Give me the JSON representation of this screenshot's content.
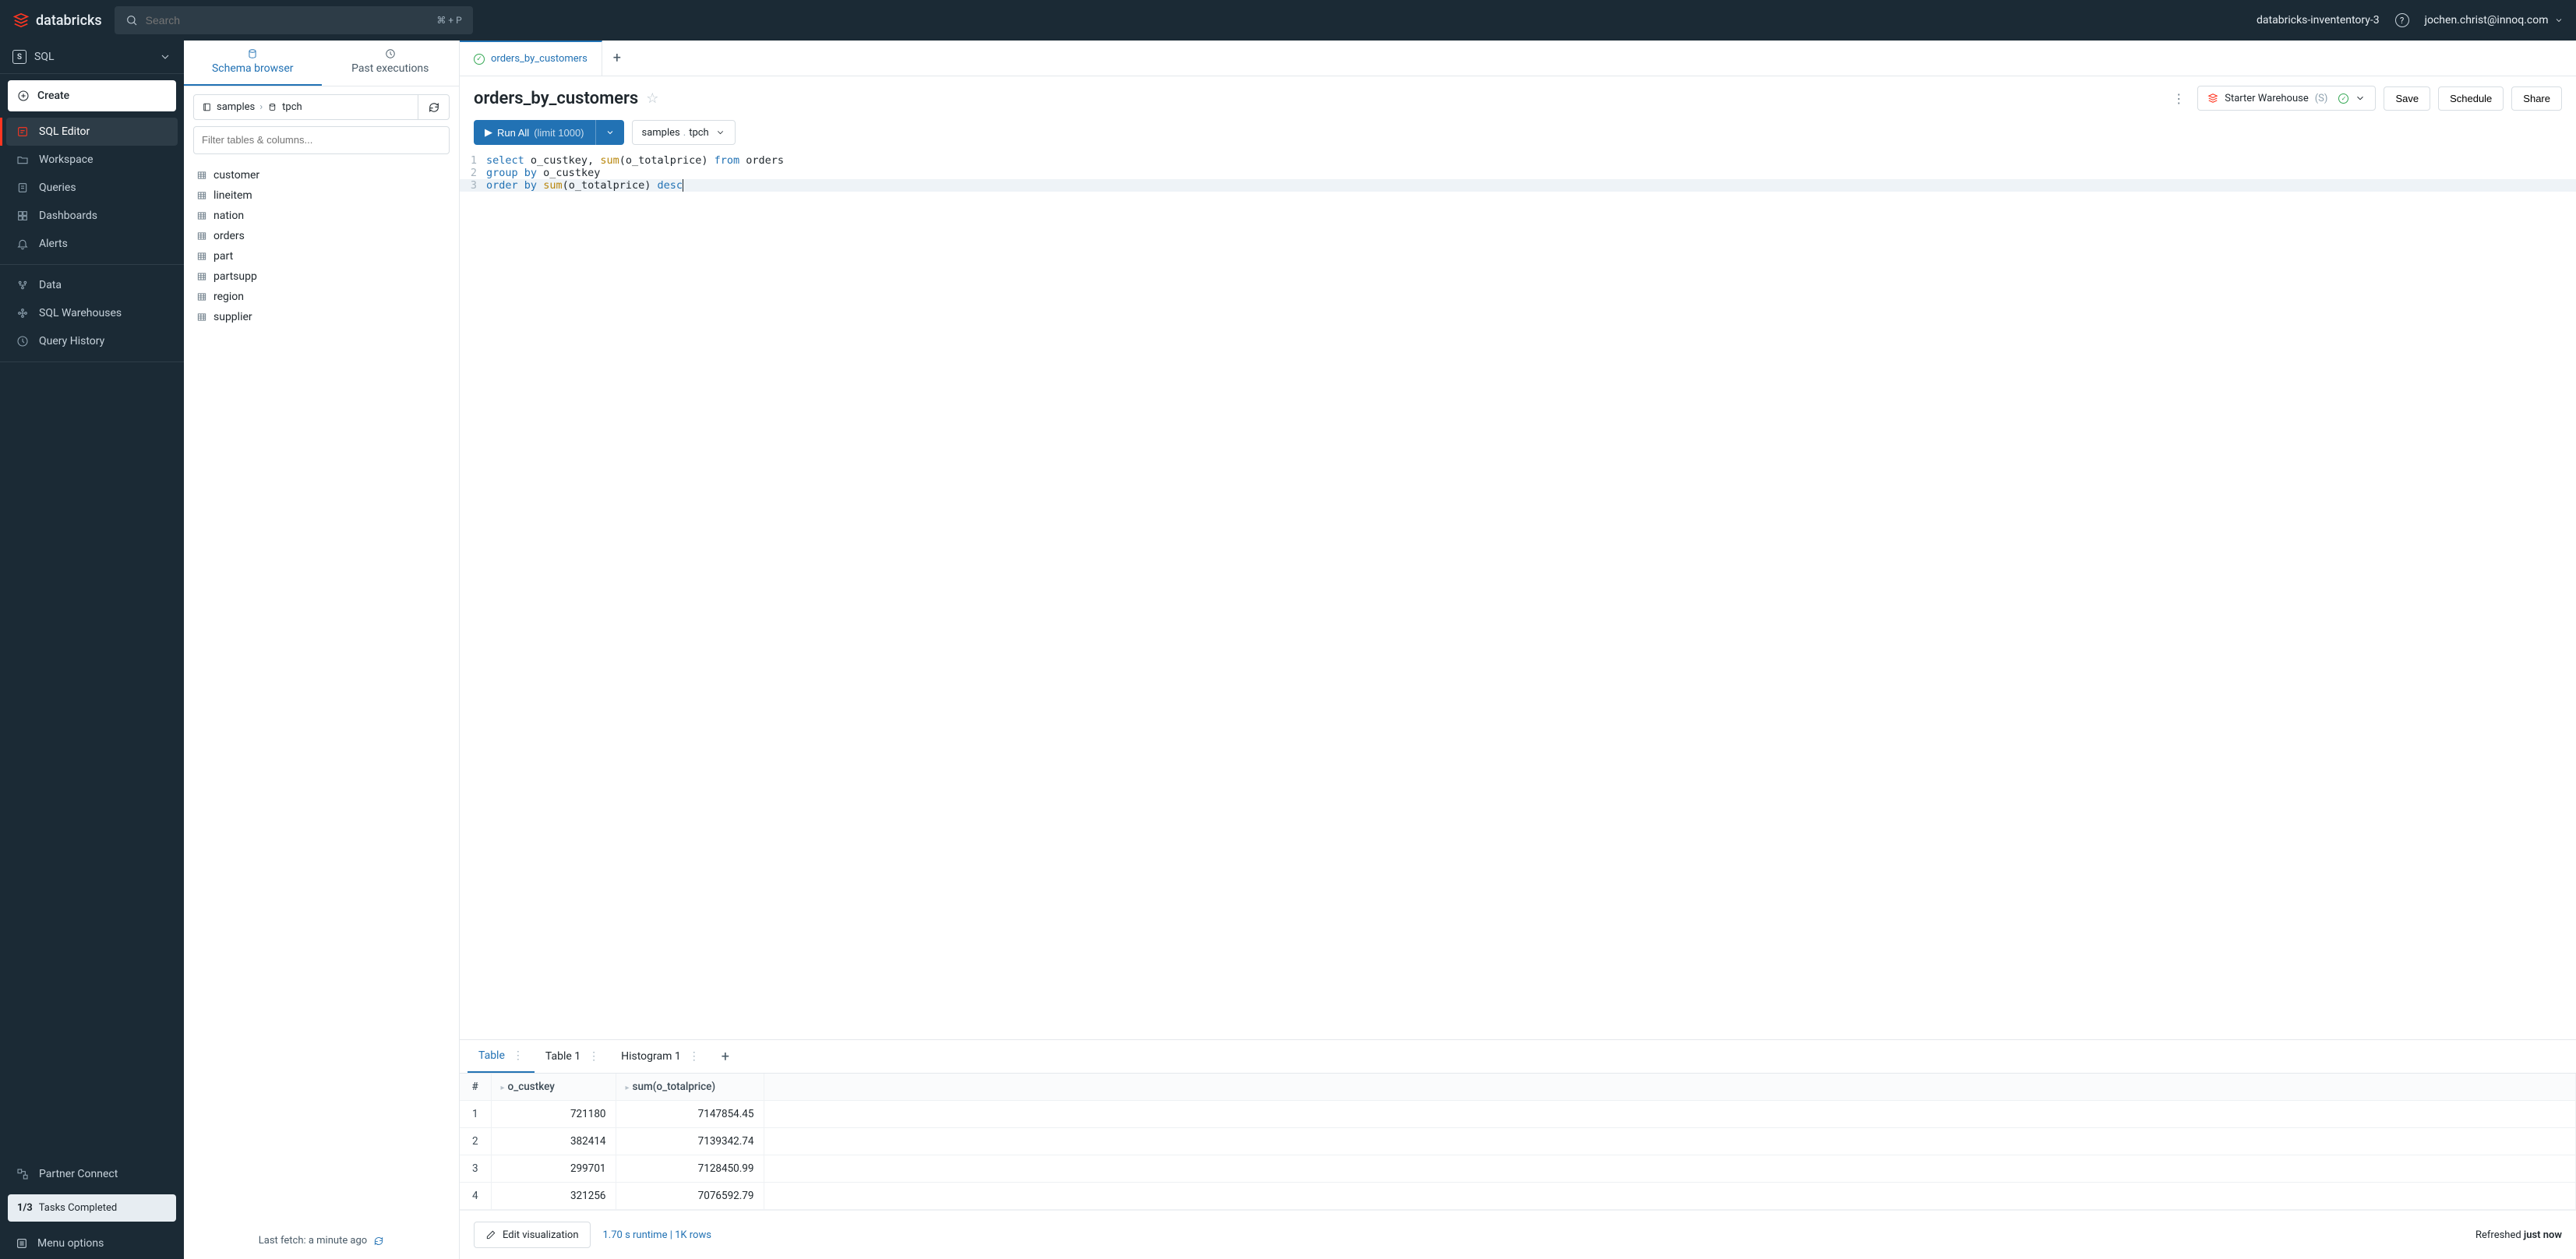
{
  "topbar": {
    "brand": "databricks",
    "search_placeholder": "Search",
    "search_shortcut": "⌘ + P",
    "workspace_name": "databricks-invententory-3",
    "user_email": "jochen.christ@innoq.com"
  },
  "sidebar": {
    "persona": "SQL",
    "create_label": "Create",
    "items": [
      {
        "label": "SQL Editor",
        "icon": "sql-editor",
        "active": true
      },
      {
        "label": "Workspace",
        "icon": "workspace"
      },
      {
        "label": "Queries",
        "icon": "queries"
      },
      {
        "label": "Dashboards",
        "icon": "dashboards"
      },
      {
        "label": "Alerts",
        "icon": "alerts"
      }
    ],
    "items2": [
      {
        "label": "Data",
        "icon": "data"
      },
      {
        "label": "SQL Warehouses",
        "icon": "warehouses"
      },
      {
        "label": "Query History",
        "icon": "history"
      }
    ],
    "partner_connect": "Partner Connect",
    "tasks_count": "1/3",
    "tasks_label": "Tasks Completed",
    "menu_options": "Menu options"
  },
  "schema_panel": {
    "tabs": {
      "browser": "Schema browser",
      "past": "Past executions"
    },
    "breadcrumb": {
      "catalog": "samples",
      "schema": "tpch"
    },
    "filter_placeholder": "Filter tables & columns...",
    "tables": [
      "customer",
      "lineitem",
      "nation",
      "orders",
      "part",
      "partsupp",
      "region",
      "supplier"
    ],
    "last_fetch": "Last fetch: a minute ago"
  },
  "editor": {
    "tab_name": "orders_by_customers",
    "title": "orders_by_customers",
    "warehouse": {
      "name": "Starter Warehouse",
      "size": "(S)"
    },
    "actions": {
      "save": "Save",
      "schedule": "Schedule",
      "share": "Share"
    },
    "run_label": "Run All",
    "run_limit": "(limit 1000)",
    "context": {
      "catalog": "samples",
      "schema": "tpch"
    },
    "code": {
      "l1a": "select",
      "l1b": " o_custkey, ",
      "l1c": "sum",
      "l1d": "(o_totalprice) ",
      "l1e": "from",
      "l1f": " orders",
      "l2a": "group",
      "l2b": " ",
      "l2c": "by",
      "l2d": " o_custkey",
      "l3a": "order",
      "l3b": " ",
      "l3c": "by",
      "l3d": " ",
      "l3e": "sum",
      "l3f": "(o_totalprice) ",
      "l3g": "desc"
    }
  },
  "results": {
    "tabs": [
      "Table",
      "Table 1",
      "Histogram 1"
    ],
    "columns": [
      "#",
      "o_custkey",
      "sum(o_totalprice)"
    ],
    "rows": [
      {
        "idx": "1",
        "custkey": "721180",
        "total": "7147854.45"
      },
      {
        "idx": "2",
        "custkey": "382414",
        "total": "7139342.74"
      },
      {
        "idx": "3",
        "custkey": "299701",
        "total": "7128450.99"
      },
      {
        "idx": "4",
        "custkey": "321256",
        "total": "7076592.79"
      }
    ],
    "edit_viz": "Edit visualization",
    "runtime": "1.70 s runtime  |  1K rows",
    "refreshed_prefix": "Refreshed ",
    "refreshed_value": "just now"
  }
}
